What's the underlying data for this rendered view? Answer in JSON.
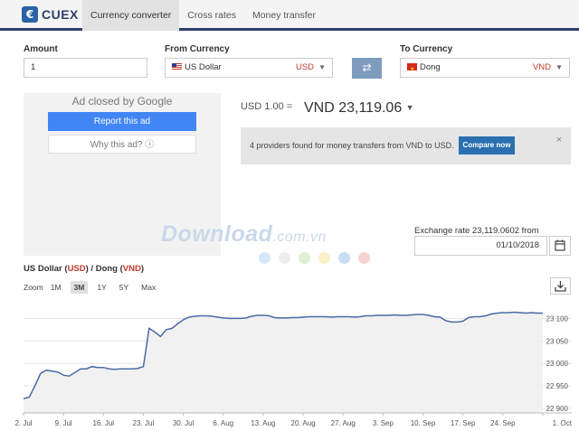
{
  "header": {
    "logo_text": "CUEX",
    "tabs": [
      {
        "label": "Currency converter",
        "active": true
      },
      {
        "label": "Cross rates",
        "active": false
      },
      {
        "label": "Money transfer",
        "active": false
      }
    ]
  },
  "form": {
    "amount_label": "Amount",
    "amount_value": "1",
    "from_label": "From Currency",
    "from_name": "US Dollar",
    "from_code": "USD",
    "to_label": "To Currency",
    "to_name": "Dong",
    "to_code": "VND"
  },
  "ad": {
    "closed_text": "Ad closed by Google",
    "report_label": "Report this ad",
    "why_label": "Why this ad? ⓘ"
  },
  "result": {
    "base": "USD 1.00 =",
    "value": "VND 23,119.06"
  },
  "notice": {
    "text": "4 providers found for money transfers from VND to USD.",
    "button": "Compare now",
    "close": "×"
  },
  "watermark": {
    "main": "Download",
    "sub": ".com.vn",
    "dot_colors": [
      "#d6e8f8",
      "#eeeeee",
      "#dfefd3",
      "#fbf1c8",
      "#c9def4",
      "#f8d3d3"
    ]
  },
  "exchange": {
    "label": "Exchange rate 23,119.0602 from",
    "date": "01/10/2018"
  },
  "chart_controls": {
    "title_prefix": "US Dollar (",
    "title_from": "USD",
    "title_mid": ") / Dong (",
    "title_to": "VND",
    "title_suffix": ")",
    "zoom_label": "Zoom",
    "zoom_options": [
      "1M",
      "3M",
      "1Y",
      "5Y",
      "Max"
    ],
    "zoom_selected": "3M"
  },
  "chart_data": {
    "type": "area",
    "title": "US Dollar (USD) / Dong (VND)",
    "x_labels": [
      "2. Jul",
      "9. Jul",
      "16. Jul",
      "23. Jul",
      "30. Jul",
      "6. Aug",
      "13. Aug",
      "20. Aug",
      "27. Aug",
      "3. Sep",
      "10. Sep",
      "17. Sep",
      "24. Sep",
      "1. Oct"
    ],
    "x_ticks_days": [
      0,
      7,
      14,
      21,
      28,
      35,
      42,
      49,
      56,
      63,
      70,
      77,
      84,
      91
    ],
    "y_ticks": [
      22900,
      22950,
      23000,
      23050,
      23100
    ],
    "y_tick_labels": [
      "22 900",
      "22 950",
      "23 000",
      "23 050",
      "23 100"
    ],
    "ylim": [
      22890,
      23125
    ],
    "x_range_days": [
      0,
      91
    ],
    "line_color": "#4a6aa5",
    "fill_color": "#f0f0f0",
    "series": [
      {
        "points": [
          [
            0,
            22922
          ],
          [
            1,
            22925
          ],
          [
            2,
            22950
          ],
          [
            3,
            22978
          ],
          [
            4,
            22985
          ],
          [
            5,
            22983
          ],
          [
            6,
            22981
          ],
          [
            7,
            22974
          ],
          [
            8,
            22972
          ],
          [
            9,
            22980
          ],
          [
            10,
            22988
          ],
          [
            11,
            22988
          ],
          [
            12,
            22993
          ],
          [
            13,
            22991
          ],
          [
            14,
            22991
          ],
          [
            15,
            22988
          ],
          [
            16,
            22987
          ],
          [
            17,
            22988
          ],
          [
            18,
            22988
          ],
          [
            19,
            22988
          ],
          [
            20,
            22989
          ],
          [
            21,
            22993
          ],
          [
            22,
            23078
          ],
          [
            23,
            23070
          ],
          [
            24,
            23060
          ],
          [
            25,
            23075
          ],
          [
            26,
            23078
          ],
          [
            27,
            23088
          ],
          [
            28,
            23097
          ],
          [
            29,
            23103
          ],
          [
            30,
            23105
          ],
          [
            31,
            23106
          ],
          [
            32,
            23106
          ],
          [
            33,
            23105
          ],
          [
            34,
            23103
          ],
          [
            35,
            23101
          ],
          [
            36,
            23100
          ],
          [
            37,
            23100
          ],
          [
            38,
            23100
          ],
          [
            39,
            23101
          ],
          [
            40,
            23105
          ],
          [
            41,
            23107
          ],
          [
            42,
            23107
          ],
          [
            43,
            23106
          ],
          [
            44,
            23102
          ],
          [
            45,
            23101
          ],
          [
            46,
            23101
          ],
          [
            47,
            23102
          ],
          [
            48,
            23102
          ],
          [
            49,
            23103
          ],
          [
            50,
            23104
          ],
          [
            51,
            23104
          ],
          [
            52,
            23104
          ],
          [
            53,
            23104
          ],
          [
            54,
            23103
          ],
          [
            55,
            23104
          ],
          [
            56,
            23104
          ],
          [
            57,
            23104
          ],
          [
            58,
            23103
          ],
          [
            59,
            23104
          ],
          [
            60,
            23106
          ],
          [
            61,
            23106
          ],
          [
            62,
            23107
          ],
          [
            63,
            23107
          ],
          [
            64,
            23107
          ],
          [
            65,
            23108
          ],
          [
            66,
            23107
          ],
          [
            67,
            23107
          ],
          [
            68,
            23108
          ],
          [
            69,
            23109
          ],
          [
            70,
            23109
          ],
          [
            71,
            23107
          ],
          [
            72,
            23104
          ],
          [
            73,
            23103
          ],
          [
            74,
            23095
          ],
          [
            75,
            23092
          ],
          [
            76,
            23092
          ],
          [
            77,
            23094
          ],
          [
            78,
            23102
          ],
          [
            79,
            23104
          ],
          [
            80,
            23104
          ],
          [
            81,
            23106
          ],
          [
            82,
            23110
          ],
          [
            83,
            23112
          ],
          [
            84,
            23113
          ],
          [
            85,
            23113
          ],
          [
            86,
            23114
          ],
          [
            87,
            23113
          ],
          [
            88,
            23112
          ],
          [
            89,
            23113
          ],
          [
            90,
            23112
          ],
          [
            91,
            23112
          ]
        ]
      }
    ]
  }
}
